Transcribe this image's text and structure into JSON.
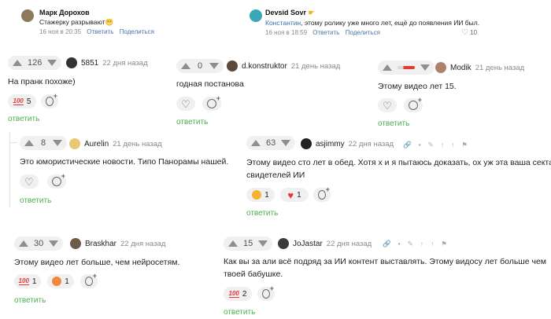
{
  "top_left": {
    "author": "Марк Дорохов",
    "text": "Стажерку разрывают",
    "emoji": "😬",
    "date": "16 ноя в 20:35",
    "reply": "Ответить",
    "share": "Поделиться"
  },
  "top_right": {
    "author": "Devsid Sovr",
    "mention": "Константин",
    "text": ", этому ролику уже много лет, ещё до появления ИИ был.",
    "date": "16 ноя в 18:59",
    "reply": "Ответить",
    "share": "Поделиться",
    "likes": "10"
  },
  "comments": {
    "c1": {
      "votes": "126",
      "user": "5851",
      "date": "22 дня назад",
      "text": "На пранк похоже)",
      "reaction_count": "5",
      "reply": "ответить"
    },
    "c2": {
      "votes": "0",
      "user": "d.konstruktor",
      "date": "21 день назад",
      "text": "годная постанова",
      "reply": "ответить"
    },
    "c3": {
      "user": "Modik",
      "date": "21 день назад",
      "text": "Этому видео лет 15.",
      "reply": "ответить",
      "vote_bar_fraction": 0.65
    },
    "c4": {
      "votes": "8",
      "user": "Aurelin",
      "date": "21 день назад",
      "text": "Это юмористические новости. Типо Панорамы нашей.",
      "reply": "ответить"
    },
    "c5": {
      "votes": "63",
      "user": "asjimmy",
      "date": "22 дня назад",
      "text_line1": "Этому видео сто лет в обед. Хотя х   и я пытаюсь доказать, ох уж эта ваша секта",
      "text_line2": "свидетелей ИИ",
      "reaction1_count": "1",
      "reaction2_count": "1",
      "reply": "ответить"
    },
    "c6": {
      "votes": "30",
      "user": "Braskhar",
      "date": "22 дня назад",
      "text": "Этому видео лет больше, чем нейросетям.",
      "reaction1_count": "1",
      "reaction2_count": "1",
      "reply": "ответить"
    },
    "c7": {
      "votes": "15",
      "user": "JoJastar",
      "date": "22 дня назад",
      "text_line1": "Как вы за   али всё подряд за ИИ контент выставлять. Этому видосу лет больше чем",
      "text_line2": "твоей бабушке.",
      "reaction_count": "2",
      "reply": "ответить"
    }
  },
  "colors": {
    "reply_green": "#4caf50",
    "link_blue": "#4a76a8",
    "heart_red": "#e53935"
  },
  "icons": [
    "vote-up-icon",
    "vote-down-icon",
    "heart-icon",
    "add-reaction-icon",
    "100-emoji-icon",
    "link-icon",
    "save-icon",
    "pin-icon",
    "flag-icon",
    "share-icon"
  ]
}
